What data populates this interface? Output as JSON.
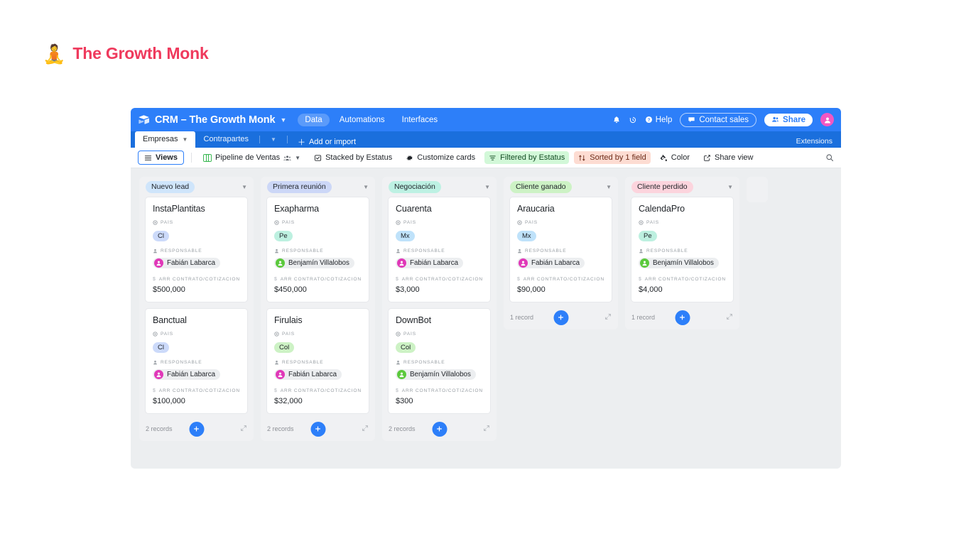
{
  "brand": {
    "emoji": "🧘",
    "text": "The Growth Monk",
    "color": "#ef3a5d"
  },
  "topbar": {
    "app_title": "CRM – The Growth Monk",
    "nav": [
      {
        "label": "Data",
        "active": true
      },
      {
        "label": "Automations",
        "active": false
      },
      {
        "label": "Interfaces",
        "active": false
      }
    ],
    "help_label": "Help",
    "contact_sales_label": "Contact sales",
    "share_label": "Share",
    "icons": [
      "bell-icon",
      "history-icon",
      "help-icon",
      "chat-icon",
      "people-icon",
      "avatar"
    ]
  },
  "tabbar": {
    "tabs": [
      {
        "label": "Empresas",
        "active": true
      },
      {
        "label": "Contrapartes",
        "active": false
      }
    ],
    "add_or_import": "Add or import",
    "extensions": "Extensions"
  },
  "toolbar": {
    "views_label": "Views",
    "view_name": "Pipeline de Ventas",
    "stacked_by": "Stacked by Estatus",
    "customize_cards": "Customize cards",
    "filtered_by": "Filtered by Estatus",
    "sorted_by": "Sorted by 1 field",
    "color": "Color",
    "share_view": "Share view",
    "filter_bg": "#d2f8d8",
    "sort_bg": "#fddcd2"
  },
  "board": {
    "field_labels": {
      "pais": "PAÍS",
      "responsable": "RESPONSABLE",
      "arr": "ARR CONTRATO/COTIZACIÓN EN U…"
    },
    "add_label": "+",
    "columns": [
      {
        "name": "Nuevo lead",
        "badge_bg": "#cfe5fb",
        "record_count": "2 records",
        "cards": [
          {
            "title": "InstaPlantitas",
            "pais": "Cl",
            "pais_bg": "#ccdafa",
            "responsable": "Fabián Labarca",
            "avatar_color": "#e038b8",
            "arr": "$500,000"
          },
          {
            "title": "Banctual",
            "pais": "Cl",
            "pais_bg": "#ccdafa",
            "responsable": "Fabián Labarca",
            "avatar_color": "#e038b8",
            "arr": "$100,000"
          }
        ]
      },
      {
        "name": "Primera reunión",
        "badge_bg": "#ccd7f7",
        "record_count": "2 records",
        "cards": [
          {
            "title": "Exapharma",
            "pais": "Pe",
            "pais_bg": "#bdf0e0",
            "responsable": "Benjamín Villalobos",
            "avatar_color": "#5bc93c",
            "arr": "$450,000"
          },
          {
            "title": "Firulais",
            "pais": "Col",
            "pais_bg": "#cdf2c5",
            "responsable": "Fabián Labarca",
            "avatar_color": "#e038b8",
            "arr": "$32,000"
          }
        ]
      },
      {
        "name": "Negociación",
        "badge_bg": "#bdf1e3",
        "record_count": "2 records",
        "cards": [
          {
            "title": "Cuarenta",
            "pais": "Mx",
            "pais_bg": "#bfe2fa",
            "responsable": "Fabián Labarca",
            "avatar_color": "#e038b8",
            "arr": "$3,000"
          },
          {
            "title": "DownBot",
            "pais": "Col",
            "pais_bg": "#cdf2c5",
            "responsable": "Benjamín Villalobos",
            "avatar_color": "#5bc93c",
            "arr": "$300"
          }
        ]
      },
      {
        "name": "Cliente ganado",
        "badge_bg": "#cdf2c5",
        "record_count": "1 record",
        "cards": [
          {
            "title": "Araucaria",
            "pais": "Mx",
            "pais_bg": "#bfe2fa",
            "responsable": "Fabián Labarca",
            "avatar_color": "#e038b8",
            "arr": "$90,000"
          }
        ]
      },
      {
        "name": "Cliente perdido",
        "badge_bg": "#fcd4dd",
        "record_count": "1 record",
        "cards": [
          {
            "title": "CalendaPro",
            "pais": "Pe",
            "pais_bg": "#bdf0e0",
            "responsable": "Benjamín Villalobos",
            "avatar_color": "#5bc93c",
            "arr": "$4,000"
          }
        ]
      }
    ]
  }
}
